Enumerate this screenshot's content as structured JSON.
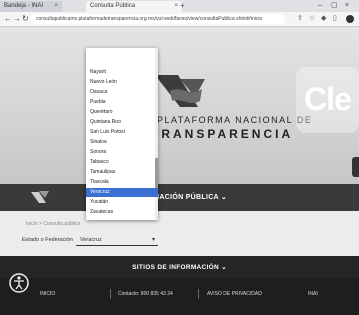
{
  "browser": {
    "tab1_title": "Bandeja - INAI",
    "tab2_title": "Consulta Pública",
    "tab_close": "×",
    "new_tab": "+",
    "window_controls": [
      "–",
      "▢",
      "×"
    ],
    "url": "consultapublicamx.plataformadetransparencia.org.mx/vut-web/faces/view/consultaPublica.xhtml#inicio"
  },
  "hero": {
    "platform_line1": "PLATAFORMA NACIONAL DE",
    "platform_line2": "TRANSPARENCIA",
    "right_partial": "Cle"
  },
  "nav": {
    "info_menu": "INFORMACIÓN PÚBLICA ⌄"
  },
  "form": {
    "breadcrumb": "Inicio > Consulta pública",
    "state_label": "Estado o Federación",
    "state_value": "Veracruz",
    "caret": "▾"
  },
  "dropdown": {
    "options": [
      "Nayarit",
      "Nuevo León",
      "Oaxaca",
      "Puebla",
      "Querétaro",
      "Quintana Roo",
      "San Luis Potosí",
      "Sinaloa",
      "Sonora",
      "Tabasco",
      "Tamaulipas",
      "Tlaxcala",
      "Veracruz",
      "Yucatán",
      "Zacatecas"
    ],
    "selected_index": 12
  },
  "sites": {
    "title": "SITIOS DE INFORMACIÓN ⌄"
  },
  "footer": {
    "items": [
      "INICIO",
      "Contacto: 800 835 43 24",
      "AVISO DE PRIVACIDAD",
      "INAI"
    ]
  },
  "colors": {
    "nav_band": "#3a3a3a",
    "footer": "#1e1e1e",
    "selected_option": "#3b6fd1"
  }
}
